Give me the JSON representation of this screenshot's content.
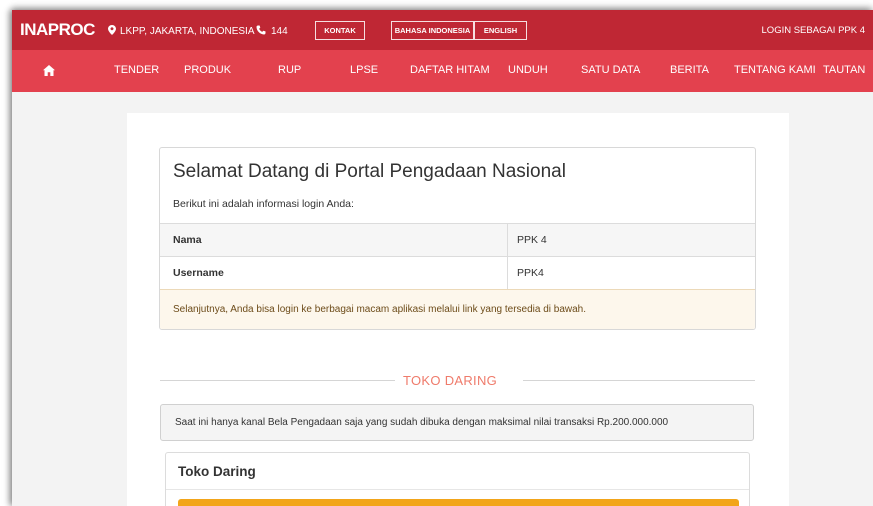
{
  "topbar": {
    "logo": "INAPROC",
    "location": "LKPP, JAKARTA, INDONESIA",
    "phone": "144",
    "kontak": "KONTAK",
    "lang_id": "BAHASA INDONESIA",
    "lang_en": "ENGLISH",
    "login_as": "LOGIN SEBAGAI PPK 4",
    "icons": {
      "location": "map-marker-icon",
      "phone": "phone-icon"
    }
  },
  "nav": {
    "home_icon": "home-icon",
    "items": [
      "TENDER",
      "PRODUK",
      "RUP",
      "LPSE",
      "DAFTAR HITAM",
      "UNDUH",
      "SATU DATA",
      "BERITA",
      "TENTANG KAMI",
      "TAUTAN"
    ]
  },
  "welcome": {
    "title": "Selamat Datang di Portal Pengadaan Nasional",
    "subtitle": "Berikut ini adalah informasi login Anda:",
    "rows": [
      {
        "label": "Nama",
        "value": "PPK 4"
      },
      {
        "label": "Username",
        "value": "PPK4"
      }
    ],
    "note": "Selanjutnya, Anda bisa login ke berbagai macam aplikasi melalui link yang tersedia di bawah."
  },
  "toko": {
    "section_title": "TOKO DARING",
    "info": "Saat ini hanya kanal Bela Pengadaan saja yang sudah dibuka dengan maksimal nilai transaksi Rp.200.000.000",
    "panel_title": "Toko Daring"
  },
  "colors": {
    "topbar": "#bf2734",
    "nav": "#e3414e",
    "section_title": "#ef7b6b",
    "note_bg": "#fdf7ec",
    "orange": "#f2a51a"
  }
}
